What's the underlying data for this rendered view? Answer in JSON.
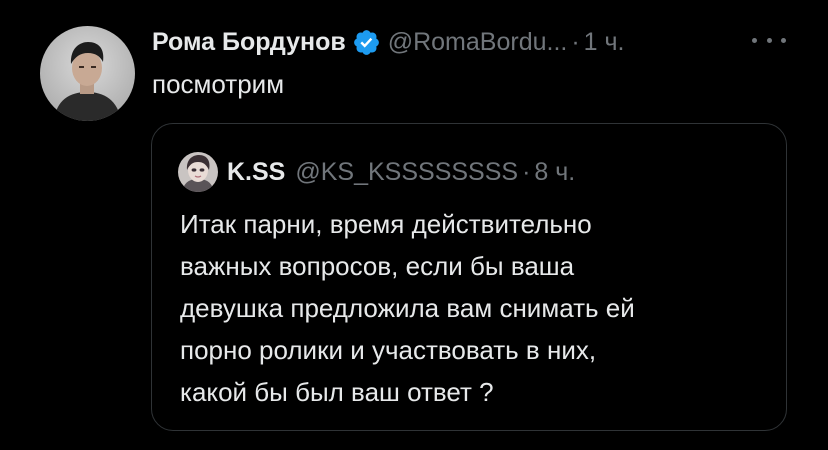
{
  "tweet": {
    "author_name": "Рома Бордунов",
    "handle": "@RomaBordu...",
    "separator": "·",
    "time": "1 ч.",
    "text": "посмотрим",
    "verified_icon": "verified-badge-icon",
    "more_icon": "more-options-icon"
  },
  "quote": {
    "author_name": "K.SS",
    "handle": "@KS_KSSSSSSSS",
    "separator": "·",
    "time": "8 ч.",
    "lines": [
      "Итак парни, время действительно",
      "важных вопросов, если бы ваша",
      "девушка предложила вам снимать ей",
      "порно ролики и участвовать в них,",
      "какой бы был ваш ответ ?"
    ]
  },
  "colors": {
    "background": "#000000",
    "primary_text": "#e7e9ea",
    "secondary_text": "#71767b",
    "border": "#2f3336",
    "verified_blue": "#1d9bf0"
  }
}
